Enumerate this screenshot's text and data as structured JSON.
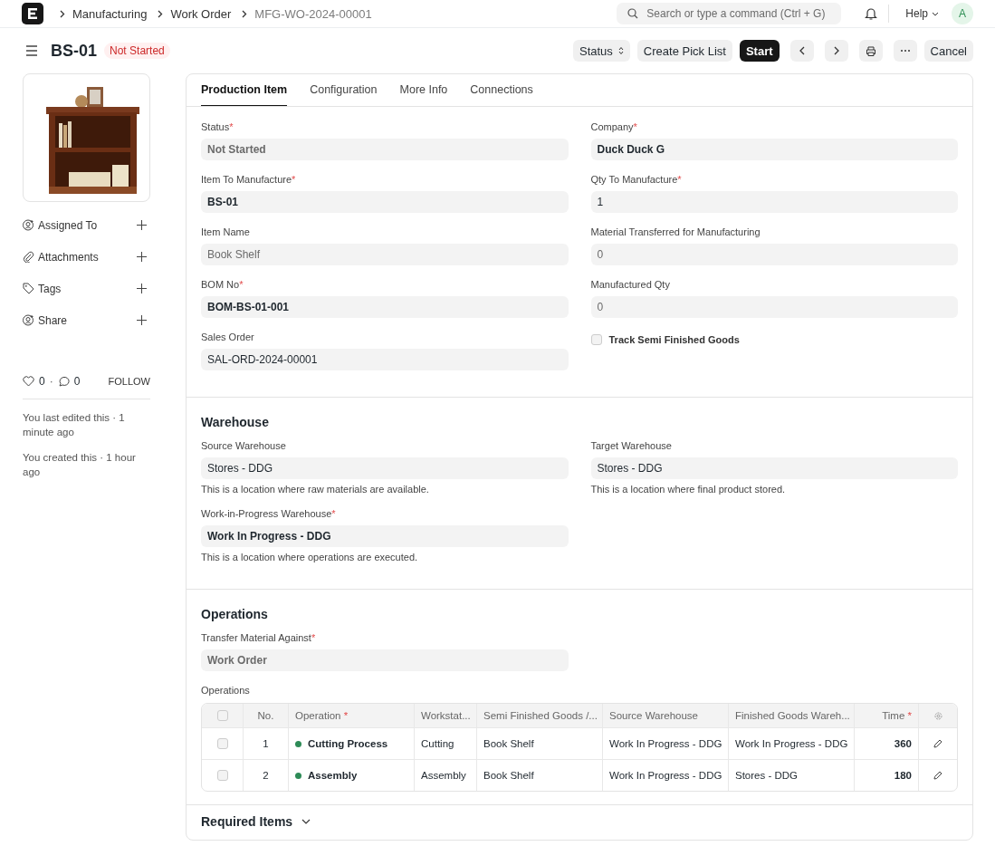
{
  "navbar": {
    "breadcrumbs": [
      {
        "label": "Manufacturing",
        "current": false
      },
      {
        "label": "Work Order",
        "current": false
      },
      {
        "label": "MFG-WO-2024-00001",
        "current": true
      }
    ],
    "search": {
      "placeholder": "Search or type a command (Ctrl + G)"
    },
    "help": "Help",
    "avatar": "A"
  },
  "header": {
    "title": "BS-01",
    "status": "Not Started",
    "buttons": [
      {
        "kind": "dropdown",
        "label": "Status"
      },
      {
        "kind": "default",
        "label": "Create Pick List"
      },
      {
        "kind": "primary",
        "label": "Start"
      },
      {
        "kind": "prev"
      },
      {
        "kind": "next"
      },
      {
        "kind": "print"
      },
      {
        "kind": "more"
      },
      {
        "kind": "default",
        "label": "Cancel"
      }
    ]
  },
  "sidebar": {
    "image": {
      "kind": "picture"
    },
    "actions": [
      {
        "kind": "assign",
        "label": "Assigned To"
      },
      {
        "kind": "attachment",
        "label": "Attachments"
      },
      {
        "kind": "tag",
        "label": "Tags"
      },
      {
        "kind": "share",
        "label": "Share"
      }
    ],
    "likes": "0",
    "separator": "·",
    "comments": "0",
    "follow": "FOLLOW",
    "activity": [
      "You last edited this · 1 minute ago",
      "You created this · 1 hour ago"
    ]
  },
  "tabs": [
    {
      "label": "Production Item",
      "selected": true
    },
    {
      "label": "Configuration",
      "selected": false
    },
    {
      "label": "More Info",
      "selected": false
    },
    {
      "label": "Connections",
      "selected": false
    }
  ],
  "sections": [
    {
      "columns": [
        [
          {
            "kind": "select",
            "label": "Status",
            "mark": "*",
            "value": "Not Started",
            "read_only": true
          },
          {
            "kind": "link",
            "label": "Item To Manufacture",
            "mark": "*",
            "value": "BS-01",
            "read_only": false
          },
          {
            "kind": "data",
            "label": "Item Name",
            "value": "Book Shelf",
            "read_only": true
          },
          {
            "kind": "link",
            "label": "BOM No",
            "mark": "*",
            "value": "BOM-BS-01-001",
            "read_only": false
          },
          {
            "kind": "data",
            "label": "Sales Order",
            "value": "SAL-ORD-2024-00001",
            "read_only": false
          }
        ],
        [
          {
            "kind": "link",
            "label": "Company",
            "mark": "*",
            "value": "Duck Duck G",
            "read_only": false
          },
          {
            "kind": "data",
            "label": "Qty To Manufacture",
            "mark": "*",
            "value": "1",
            "read_only": false
          },
          {
            "kind": "data",
            "label": "Material Transferred for Manufacturing",
            "value": "0",
            "read_only": true
          },
          {
            "kind": "data",
            "label": "Manufactured Qty",
            "value": "0",
            "read_only": true
          },
          {
            "kind": "checkbox",
            "label": "Track Semi Finished Goods",
            "checked": false
          }
        ]
      ]
    },
    {
      "title": "Warehouse",
      "columns": [
        [
          {
            "kind": "data",
            "label": "Source Warehouse",
            "value": "Stores - DDG",
            "read_only": false,
            "description": "This is a location where raw materials are available."
          },
          {
            "kind": "link",
            "label": "Work-in-Progress Warehouse",
            "mark": "*",
            "value": "Work In Progress - DDG",
            "read_only": false,
            "description": "This is a location where operations are executed."
          }
        ],
        [
          {
            "kind": "data",
            "label": "Target Warehouse",
            "value": "Stores - DDG",
            "read_only": false,
            "description": "This is a location where final product stored."
          }
        ]
      ]
    },
    {
      "title": "Operations",
      "columns": [
        [
          {
            "kind": "select",
            "label": "Transfer Material Against",
            "mark": "*",
            "value": "Work Order",
            "read_only": true
          }
        ],
        []
      ],
      "table": {
        "label": "Operations",
        "all_selected": false,
        "columns": [
          {
            "label": "No."
          },
          {
            "label": "Operation",
            "mark": "*"
          },
          {
            "label": "Workstat..."
          },
          {
            "label": "Semi Finished Goods /..."
          },
          {
            "label": "Source Warehouse"
          },
          {
            "label": "Finished Goods Wareh..."
          },
          {
            "label": "Time",
            "mark": "*"
          }
        ],
        "rows": [
          {
            "selected": false,
            "no": "1",
            "operation": "Cutting Process",
            "color": "#2e8b57",
            "workstation": "Cutting",
            "semi_finished": "Book Shelf",
            "source": "Work In Progress - DDG",
            "finished": "Work In Progress - DDG",
            "time": "360"
          },
          {
            "selected": false,
            "no": "2",
            "operation": "Assembly",
            "color": "#2e8b57",
            "workstation": "Assembly",
            "semi_finished": "Book Shelf",
            "source": "Work In Progress - DDG",
            "finished": "Stores - DDG",
            "time": "180"
          }
        ]
      }
    }
  ],
  "collapsed_section": {
    "title": "Required Items",
    "expanded": false
  }
}
